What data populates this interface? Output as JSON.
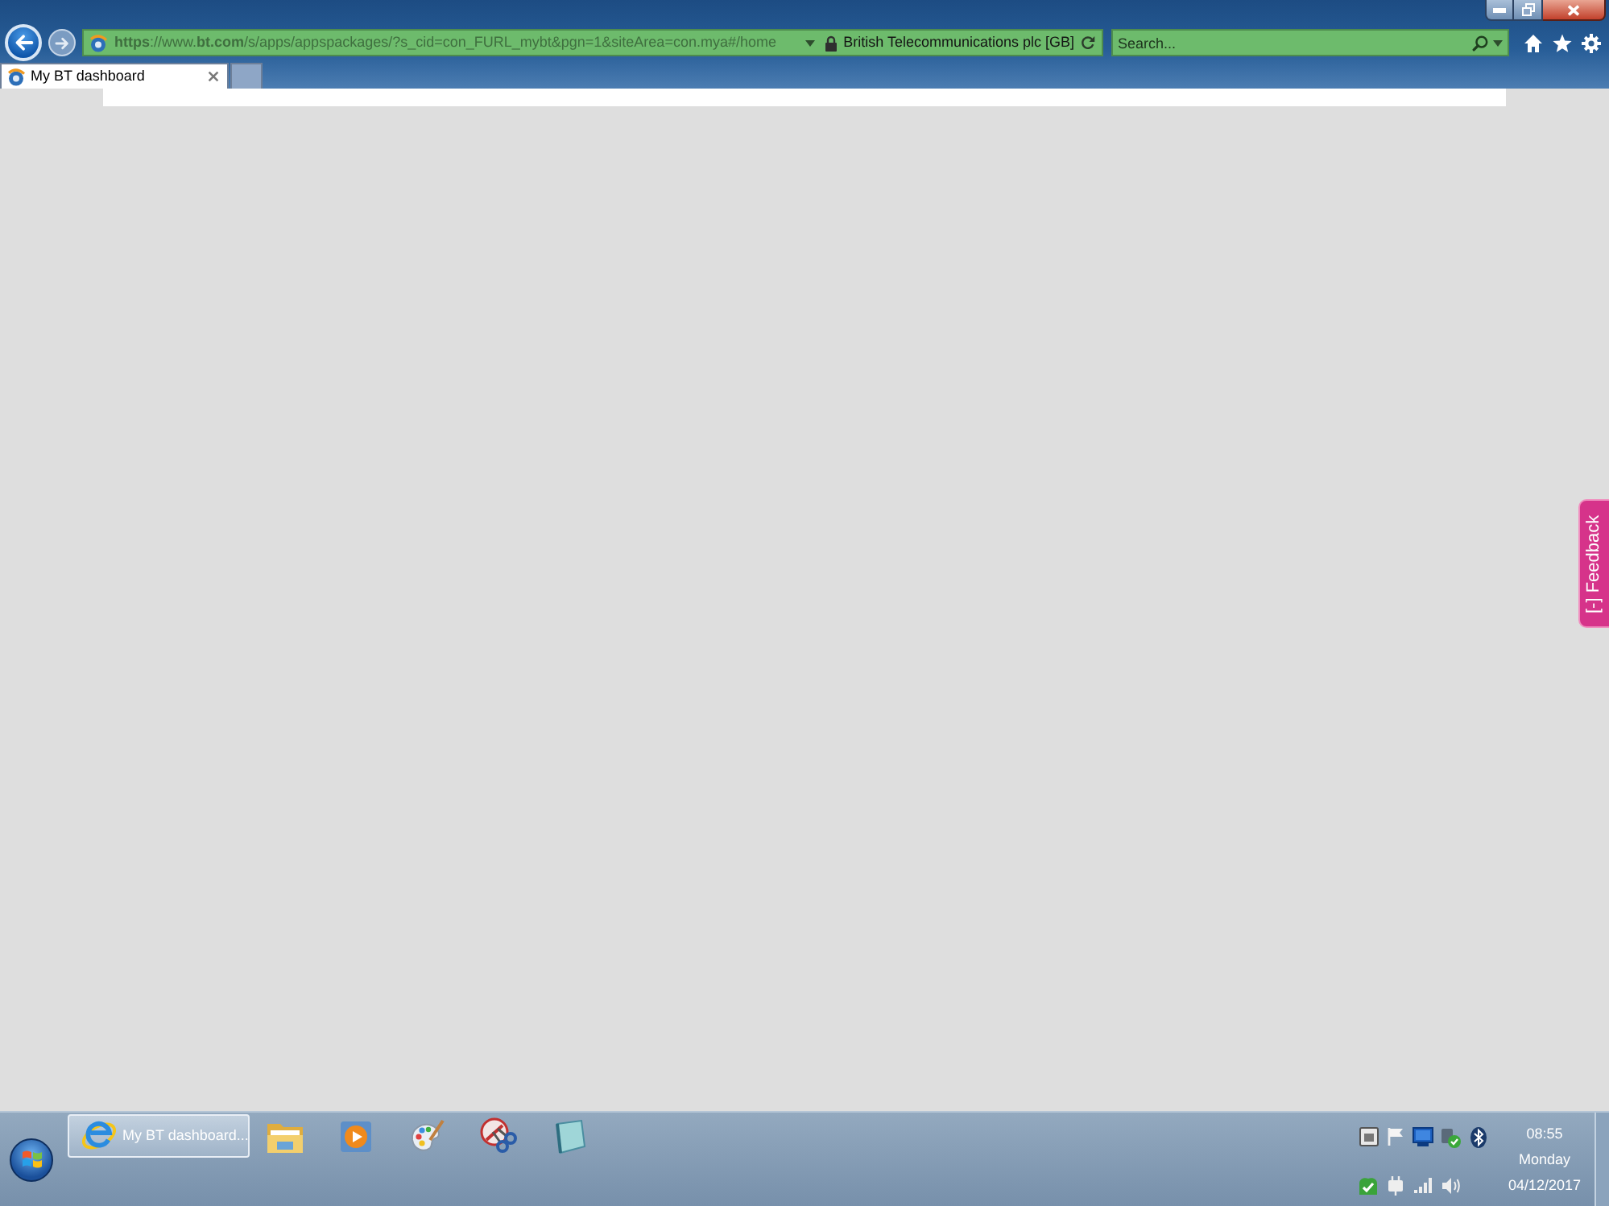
{
  "address_bar": {
    "url": "**https**://www.**bt.com**/s/apps/appspackages/?s_cid=con_FURL_mybt&pgn=1&siteArea=con.mya#/home",
    "site_identity": "British Telecommunications plc [GB]"
  },
  "search": {
    "placeholder": "Search..."
  },
  "tabs": [
    {
      "label": "My BT dashboard",
      "selected": true
    }
  ],
  "feedback_tab": {
    "label": "[-] Feedback"
  },
  "taskbar": {
    "windows": [
      {
        "label": "My BT dashboard...",
        "selected": true
      }
    ],
    "clock": {
      "time": "08:55",
      "day": "Monday",
      "date": "04/12/2017"
    }
  }
}
